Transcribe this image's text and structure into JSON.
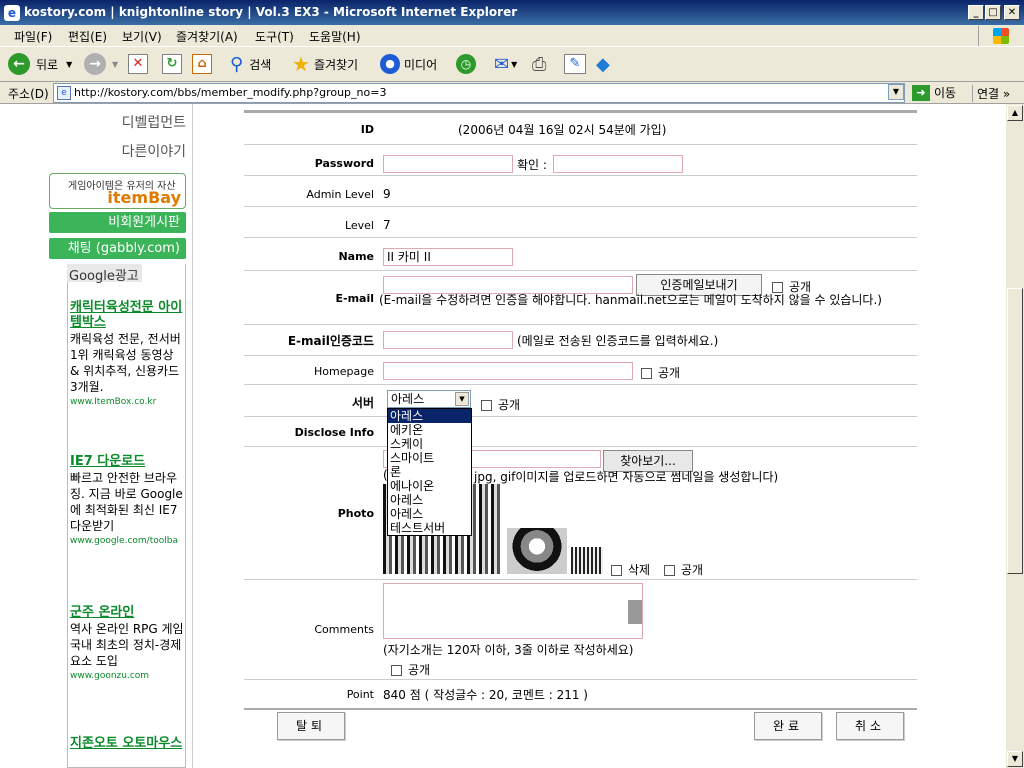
{
  "window": {
    "title": "kostory.com | knightonline story | Vol.3 EX3 - Microsoft Internet Explorer"
  },
  "menu": [
    "파일(F)",
    "편집(E)",
    "보기(V)",
    "즐겨찾기(A)",
    "도구(T)",
    "도움말(H)"
  ],
  "toolbar": {
    "back": "뒤로",
    "search": "검색",
    "favorites": "즐겨찾기",
    "media": "미디어"
  },
  "address": {
    "label": "주소(D)",
    "url": "http://kostory.com/bbs/member_modify.php?group_no=3",
    "go": "이동",
    "links": "연결"
  },
  "sidebar": {
    "developer": "디벨럽먼트",
    "other": "다른이야기",
    "itembay_slogan": "게임아이템은 유저의 자산",
    "itembay_logo": "itemBay",
    "nonmember_board": "비회원게시판",
    "chat": "채팅 (gabbly.com)",
    "google_ads": "Google광고",
    "ads": [
      {
        "title": "캐릭터육성전문 아이템박스",
        "body": "캐릭육성 전문, 전서버 1위 캐릭육성 동영상 & 위치추적, 신용카드 3개월.",
        "url": "www.ItemBox.co.kr"
      },
      {
        "title": "IE7 다운로드",
        "body": "빠르고 안전한 브라우징. 지금 바로 Google에 최적화된 최신 IE7 다운받기",
        "url": "www.google.com/toolba"
      },
      {
        "title": "군주 온라인",
        "body": "역사 온라인 RPG 게임 국내 최초의 정치-경제요소 도입",
        "url": "www.goonzu.com"
      },
      {
        "title": "지존오토 오토마우스"
      }
    ]
  },
  "form": {
    "id_label": "ID",
    "id_value": "(2006년 04월 16일 02시 54분에 가입)",
    "password_label": "Password",
    "confirm_label": "확인 :",
    "admin_level_label": "Admin Level",
    "admin_level_value": "9",
    "level_label": "Level",
    "level_value": "7",
    "name_label": "Name",
    "name_value": "II 카미 II",
    "email_label": "E-mail",
    "email_send_button": "인증메일보내기",
    "public": "공개",
    "email_note": "(E-mail을 수정하려면 인증을 해야합니다. hanmail.net으로는 메일이 도착하지 않을 수 있습니다.)",
    "email_code_label": "E-mail인증코드",
    "email_code_note": "(메일로 전송된 인증코드를 입력하세요.)",
    "homepage_label": "Homepage",
    "server_label": "서버",
    "server_selected": "아레스",
    "server_options": [
      "아레스",
      "에키온",
      "스케이",
      "스마이트",
      "론",
      "에나이온",
      "아레스",
      "아레스",
      "테스트서버"
    ],
    "disclose_label": "Disclose Info",
    "browse_button": "찾아보기...",
    "photo_note": "jpg, gif이미지를 업로드하면 자동으로 썸네일을 생성합니다)",
    "photo_label": "Photo",
    "delete_label": "삭제",
    "comments_label": "Comments",
    "comments_note": "(자기소개는 120자 이하, 3줄 이하로 작성하세요)",
    "point_label": "Point",
    "point_value": "840 점 ( 작성글수 : 20, 코멘트 : 211 )",
    "withdraw_button": "탈퇴",
    "complete_button": "완료",
    "cancel_button": "취소"
  }
}
